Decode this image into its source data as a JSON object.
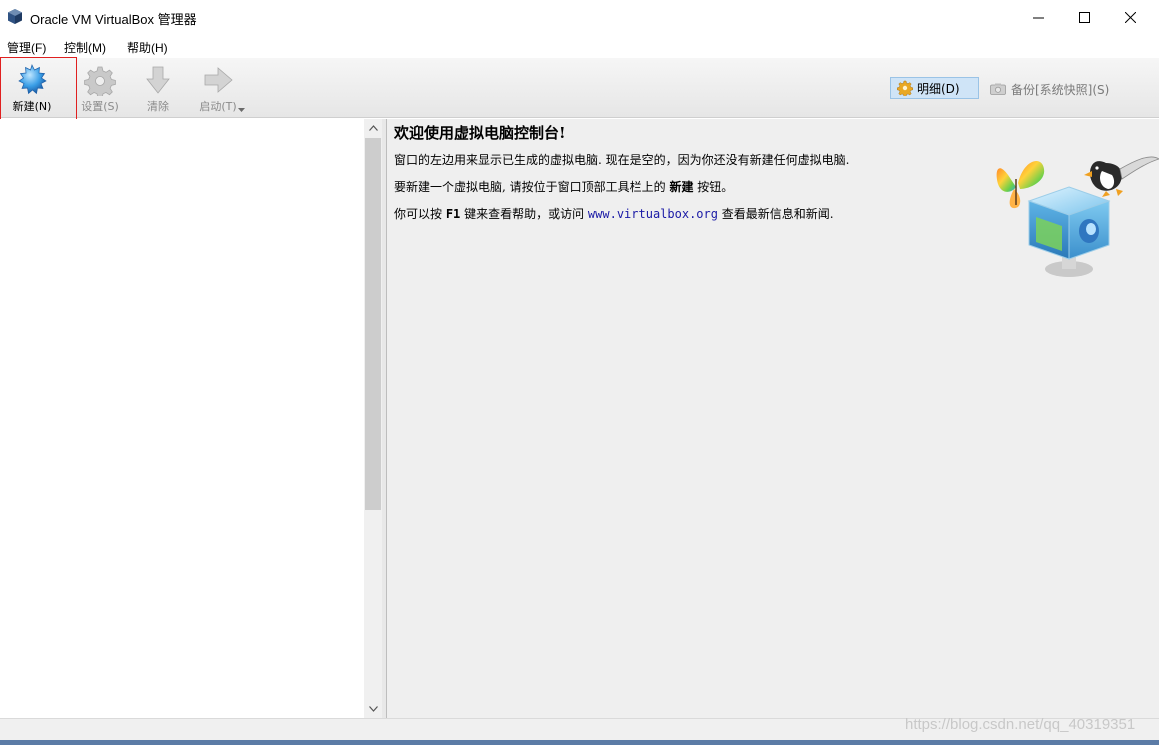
{
  "window": {
    "title": "Oracle VM VirtualBox 管理器"
  },
  "menubar": {
    "items": [
      {
        "label": "管理(F)"
      },
      {
        "label": "控制(M)"
      },
      {
        "label": "帮助(H)"
      }
    ]
  },
  "toolbar": {
    "new_label": "新建(N)",
    "settings_label": "设置(S)",
    "discard_label": "清除",
    "start_label": "启动(T)",
    "details_label": "明细(D)",
    "snapshots_label": "备份[系统快照](S)"
  },
  "welcome": {
    "title": "欢迎使用虚拟电脑控制台!",
    "line1": "窗口的左边用来显示已生成的虚拟电脑. 现在是空的，因为你还没有新建任何虚拟电脑.",
    "line2_pre": "要新建一个虚拟电脑, 请按位于窗口顶部工具栏上的 ",
    "line2_bold": "新建",
    "line2_post": " 按钮。",
    "line3_pre": "你可以按 ",
    "line3_key": "F1",
    "line3_mid": " 键来查看帮助，或访问 ",
    "line3_link": "www.virtualbox.org",
    "line3_post": " 查看最新信息和新闻."
  },
  "watermark": "https://blog.csdn.net/qq_40319351",
  "icons": {
    "app": "virtualbox-icon",
    "new": "new-vm-icon",
    "settings": "gear-icon",
    "discard": "arrow-down-icon",
    "start": "arrow-right-icon",
    "details": "gear-icon",
    "snapshots": "camera-icon"
  },
  "colors": {
    "highlight": "#e02020",
    "link": "#1a1aa6",
    "details_bg": "#cfe4f7"
  }
}
